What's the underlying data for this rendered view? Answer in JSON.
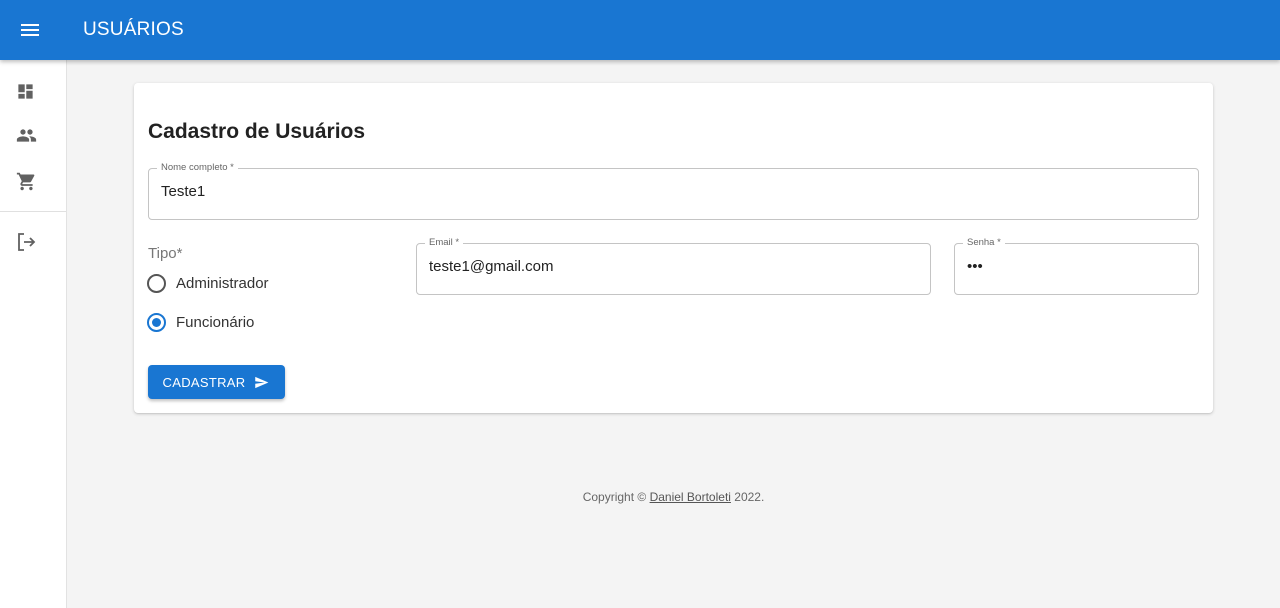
{
  "appbar": {
    "title": "USUÁRIOS"
  },
  "form": {
    "title": "Cadastro de Usuários",
    "nome": {
      "label": "Nome completo *",
      "value": "Teste1"
    },
    "email": {
      "label": "Email *",
      "value": "teste1@gmail.com"
    },
    "senha": {
      "label": "Senha *",
      "value": "•••"
    },
    "tipo": {
      "label": "Tipo*",
      "options": [
        {
          "label": "Administrador",
          "checked": false
        },
        {
          "label": "Funcionário",
          "checked": true
        }
      ]
    },
    "submit_label": "CADASTRAR"
  },
  "footer": {
    "prefix": "Copyright © ",
    "link": "Daniel Bortoleti",
    "suffix": " 2022."
  },
  "colors": {
    "primary": "#1976d2",
    "background": "#f4f4f4",
    "icon": "#616161"
  },
  "icons": [
    "menu-icon",
    "dashboard-icon",
    "people-icon",
    "cart-icon",
    "logout-icon",
    "send-icon"
  ]
}
